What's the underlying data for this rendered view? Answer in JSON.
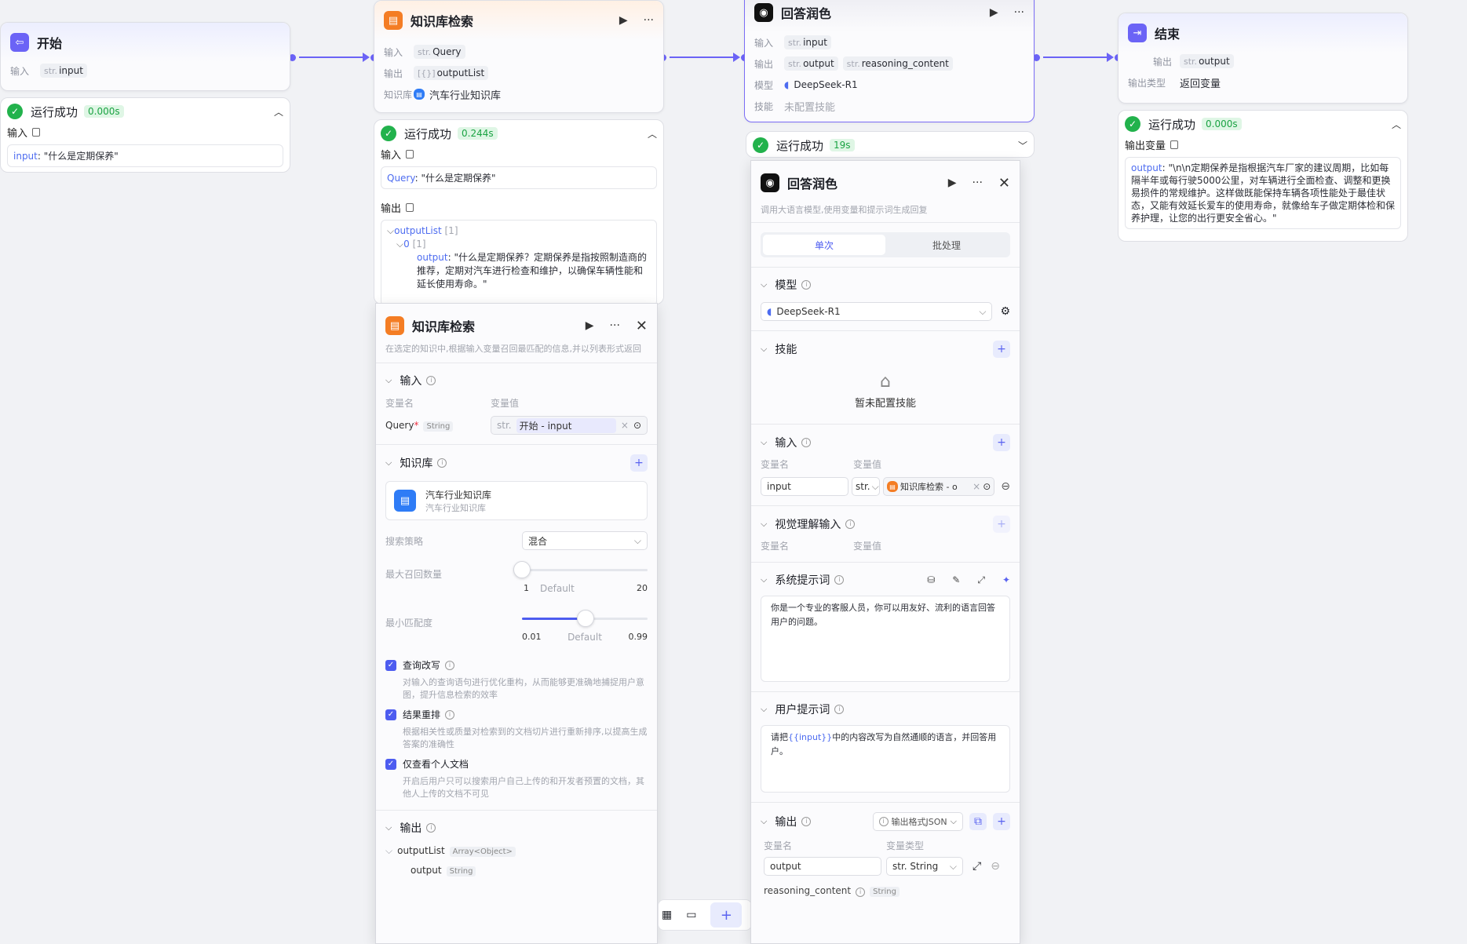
{
  "start": {
    "title": "开始",
    "in_label": "输入",
    "in_type": "str.",
    "in_var": "input"
  },
  "start_run": {
    "status": "运行成功",
    "time": "0.000s",
    "input_label": "输入",
    "value_key": "input",
    "value": ": \"什么是定期保养\""
  },
  "kb": {
    "title": "知识库检索",
    "in_label": "输入",
    "in_type": "str.",
    "in_var": "Query",
    "out_label": "输出",
    "out_type": "[{}]",
    "out_var": "outputList",
    "lib_label": "知识库",
    "lib_name": "汽车行业知识库"
  },
  "kb_run": {
    "status": "运行成功",
    "time": "0.244s",
    "input_label": "输入",
    "query_key": "Query",
    "query_val": ": \"什么是定期保养\"",
    "output_label": "输出",
    "list_key": "outputList",
    "list_count": "[1]",
    "idx": "0",
    "idx_count": "[1]",
    "out_key": "output",
    "out_val": ": \"什么是定期保养？定期保养是指按照制造商的推荐，定期对汽车进行检查和维护，以确保车辆性能和延长使用寿命。\""
  },
  "answer": {
    "title": "回答润色",
    "in_label": "输入",
    "in_type": "str.",
    "in_var": "input",
    "out_label": "输出",
    "out1_type": "str.",
    "out1": "output",
    "out2_type": "str.",
    "out2": "reasoning_content",
    "model_label": "模型",
    "model": "DeepSeek-R1",
    "skill_label": "技能",
    "skill": "未配置技能"
  },
  "answer_run": {
    "status": "运行成功",
    "time": "19s"
  },
  "end": {
    "title": "结束",
    "out_label": "输出",
    "out_type": "str.",
    "out_var": "output",
    "type_label": "输出类型",
    "type_val": "返回变量"
  },
  "end_run": {
    "status": "运行成功",
    "time": "0.000s",
    "var_label": "输出变量",
    "out_key": "output",
    "out_val": ": \"\\n\\n定期保养是指根据汽车厂家的建议周期，比如每隔半年或每行驶5000公里，对车辆进行全面检查、调整和更换易损件的常规维护。这样做既能保持车辆各项性能处于最佳状态，又能有效延长爱车的使用寿命，就像给车子做定期体检和保养护理，让您的出行更安全省心。\""
  },
  "kb_panel": {
    "title": "知识库检索",
    "desc": "在选定的知识中,根据输入变量召回最匹配的信息,并以列表形式返回",
    "input_title": "输入",
    "col_name": "变量名",
    "col_value": "变量值",
    "var_name": "Query",
    "required": "*",
    "var_type": "String",
    "val_type": "str.",
    "val_src": "开始 - input",
    "lib_title": "知识库",
    "lib_name": "汽车行业知识库",
    "lib_desc": "汽车行业知识库",
    "strategy_label": "搜索策略",
    "strategy": "混合",
    "max_label": "最大召回数量",
    "max_min": "1",
    "max_default": "Default",
    "max_max": "20",
    "max_value": 1,
    "min_label": "最小匹配度",
    "min_min": "0.01",
    "min_default": "Default",
    "min_max": "0.99",
    "min_value": 0.5,
    "opt1": "查询改写",
    "opt1_desc": "对输入的查询语句进行优化重构，从而能够更准确地捕捉用户意图，提升信息检索的效率",
    "opt2": "结果重排",
    "opt2_desc": "根据相关性或质量对检索到的文档切片进行重新排序,以提高生成答案的准确性",
    "opt3": "仅查看个人文档",
    "opt3_desc": "开启后用户只可以搜索用户自己上传的和开发者预置的文档，其他人上传的文档不可见",
    "out_title": "输出",
    "out_list": "outputList",
    "out_list_type": "Array<Object>",
    "out_item": "output",
    "out_item_type": "String"
  },
  "ans_panel": {
    "title": "回答润色",
    "desc": "调用大语言模型,使用变量和提示词生成回复",
    "tab_single": "单次",
    "tab_batch": "批处理",
    "model_title": "模型",
    "model": "DeepSeek-R1",
    "skill_title": "技能",
    "skill_empty": "暂未配置技能",
    "input_title": "输入",
    "col_name": "变量名",
    "col_value": "变量值",
    "var_name": "input",
    "var_type": "str.",
    "var_src": "知识库检索 - o",
    "vision_title": "视觉理解输入",
    "v_col_name": "变量名",
    "v_col_value": "变量值",
    "sys_title": "系统提示词",
    "sys_text": "你是一个专业的客服人员，你可以用友好、流利的语言回答用户的问题。",
    "user_title": "用户提示词",
    "user_pre": "请把",
    "user_var": "{{input}}",
    "user_post": "中的内容改写为自然通顺的语言，并回答用户。",
    "out_title": "输出",
    "out_format": "输出格式JSON",
    "out_col_name": "变量名",
    "out_col_type": "变量类型",
    "out_var": "output",
    "out_var_type": "str. String",
    "reason_var": "reasoning_content",
    "reason_type": "String"
  },
  "toolbar": {
    "add": "+"
  }
}
